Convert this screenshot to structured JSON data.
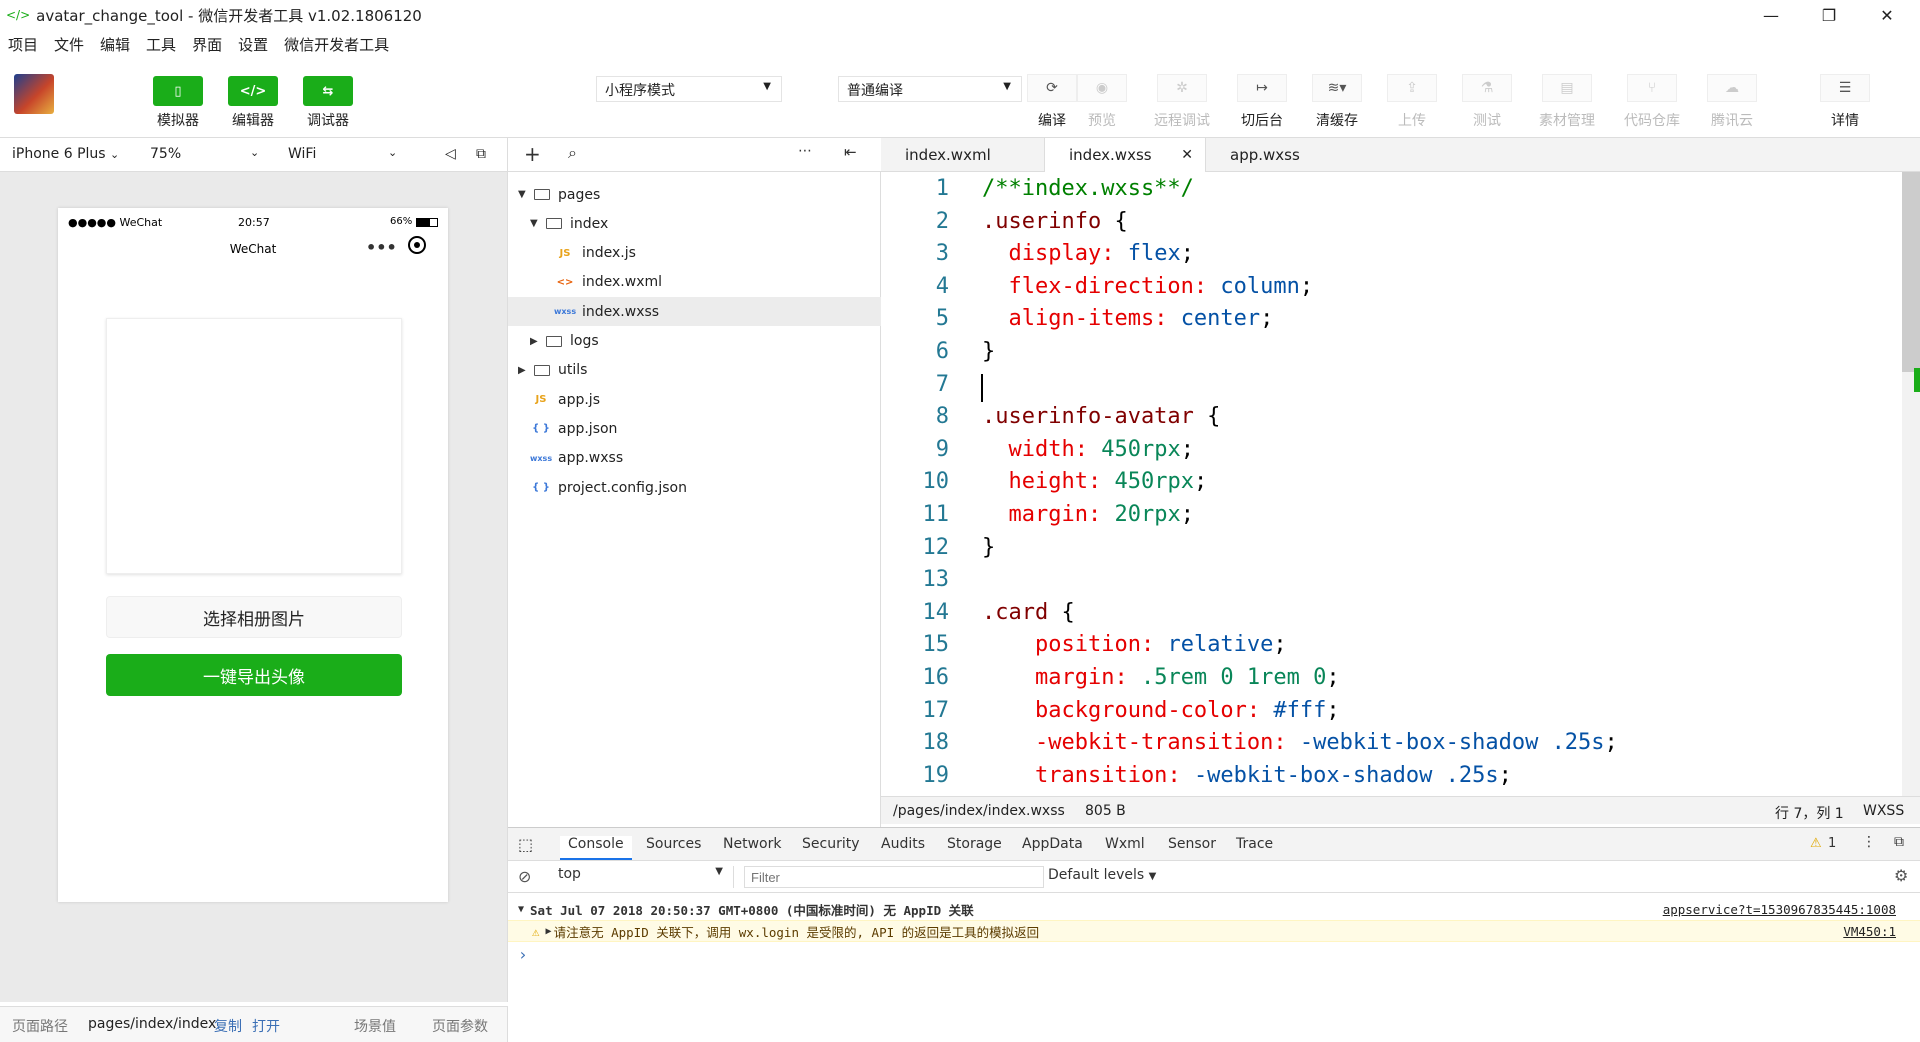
{
  "window": {
    "title": "avatar_change_tool - 微信开发者工具 v1.02.1806120",
    "minimize_glyph": "—",
    "restore_glyph": "❐",
    "close_glyph": "✕"
  },
  "menu": [
    "项目",
    "文件",
    "编辑",
    "工具",
    "界面",
    "设置",
    "微信开发者工具"
  ],
  "toolbar": {
    "simulator_label": "模拟器",
    "editor_label": "编辑器",
    "debugger_label": "调试器",
    "mode_select": "小程序模式",
    "compile_select": "普通编译",
    "compile_label": "编译",
    "preview_label": "预览",
    "remote_debug_label": "远程调试",
    "background_label": "切后台",
    "clear_cache_label": "清缓存",
    "upload_label": "上传",
    "test_label": "测试",
    "assets_label": "素材管理",
    "repo_label": "代码仓库",
    "tencent_cloud_label": "腾讯云",
    "details_label": "详情"
  },
  "simulator": {
    "device": "iPhone 6 Plus",
    "zoom": "75%",
    "network": "WiFi",
    "status_carrier": "●●●●● WeChat",
    "status_time": "20:57",
    "status_battery": "66%",
    "nav_title": "WeChat",
    "choose_button": "选择相册图片",
    "export_button": "一键导出头像"
  },
  "sim_footer": {
    "path_label": "页面路径",
    "path": "pages/index/index",
    "copy": "复制",
    "open": "打开",
    "scene": "场景值",
    "params": "页面参数"
  },
  "tree": [
    {
      "name": "pages",
      "type": "folder",
      "open": true,
      "depth": 0
    },
    {
      "name": "index",
      "type": "folder",
      "open": true,
      "depth": 1
    },
    {
      "name": "index.js",
      "type": "js",
      "depth": 2
    },
    {
      "name": "index.wxml",
      "type": "wxml",
      "depth": 2
    },
    {
      "name": "index.wxss",
      "type": "wxss",
      "depth": 2,
      "selected": true
    },
    {
      "name": "logs",
      "type": "folder",
      "open": false,
      "depth": 1
    },
    {
      "name": "utils",
      "type": "folder",
      "open": false,
      "depth": 0
    },
    {
      "name": "app.js",
      "type": "js",
      "depth": 0
    },
    {
      "name": "app.json",
      "type": "json",
      "depth": 0
    },
    {
      "name": "app.wxss",
      "type": "wxss",
      "depth": 0
    },
    {
      "name": "project.config.json",
      "type": "json",
      "depth": 0
    }
  ],
  "file_icons": {
    "js": "JS",
    "wxml": "<>",
    "wxss": "wxss",
    "json": "{ }"
  },
  "editor_tabs": [
    "index.wxml",
    "index.wxss",
    "app.wxss"
  ],
  "active_tab": "index.wxss",
  "code_lines": [
    [
      [
        "/**index.wxss**/",
        "cm"
      ]
    ],
    [
      [
        ".userinfo",
        "sel"
      ],
      [
        " {",
        "p"
      ]
    ],
    [
      [
        "  display",
        "prop"
      ],
      [
        ": ",
        "prop"
      ],
      [
        "flex",
        "val"
      ],
      [
        ";",
        "p"
      ]
    ],
    [
      [
        "  flex-direction",
        "prop"
      ],
      [
        ": ",
        "prop"
      ],
      [
        "column",
        "val"
      ],
      [
        ";",
        "p"
      ]
    ],
    [
      [
        "  align-items",
        "prop"
      ],
      [
        ": ",
        "prop"
      ],
      [
        "center",
        "val"
      ],
      [
        ";",
        "p"
      ]
    ],
    [
      [
        "}",
        "p"
      ]
    ],
    [
      [
        "",
        "p"
      ]
    ],
    [
      [
        ".userinfo-avatar",
        "sel"
      ],
      [
        " {",
        "p"
      ]
    ],
    [
      [
        "  width",
        "prop"
      ],
      [
        ": ",
        "prop"
      ],
      [
        "450rpx",
        "num"
      ],
      [
        ";",
        "p"
      ]
    ],
    [
      [
        "  height",
        "prop"
      ],
      [
        ": ",
        "prop"
      ],
      [
        "450rpx",
        "num"
      ],
      [
        ";",
        "p"
      ]
    ],
    [
      [
        "  margin",
        "prop"
      ],
      [
        ": ",
        "prop"
      ],
      [
        "20rpx",
        "num"
      ],
      [
        ";",
        "p"
      ]
    ],
    [
      [
        "}",
        "p"
      ]
    ],
    [
      [
        "",
        "p"
      ]
    ],
    [
      [
        ".card",
        "sel"
      ],
      [
        " {",
        "p"
      ]
    ],
    [
      [
        "    position",
        "prop"
      ],
      [
        ": ",
        "prop"
      ],
      [
        "relative",
        "val"
      ],
      [
        ";",
        "p"
      ]
    ],
    [
      [
        "    margin",
        "prop"
      ],
      [
        ": ",
        "prop"
      ],
      [
        ".5rem 0 1rem 0",
        "num"
      ],
      [
        ";",
        "p"
      ]
    ],
    [
      [
        "    background-color",
        "prop"
      ],
      [
        ": ",
        "prop"
      ],
      [
        "#fff",
        "val"
      ],
      [
        ";",
        "p"
      ]
    ],
    [
      [
        "    -webkit-transition",
        "prop"
      ],
      [
        ": ",
        "prop"
      ],
      [
        "-webkit-box-shadow .25s",
        "val"
      ],
      [
        ";",
        "p"
      ]
    ],
    [
      [
        "    transition",
        "prop"
      ],
      [
        ": ",
        "prop"
      ],
      [
        "-webkit-box-shadow .25s",
        "val"
      ],
      [
        ";",
        "p"
      ]
    ]
  ],
  "editor_status": {
    "path": "/pages/index/index.wxss",
    "size": "805 B",
    "cursor": "行 7，列 1",
    "lang": "WXSS"
  },
  "devtools": {
    "tabs": [
      "Console",
      "Sources",
      "Network",
      "Security",
      "Audits",
      "Storage",
      "AppData",
      "Wxml",
      "Sensor",
      "Trace"
    ],
    "active": "Console",
    "warn_count": "1",
    "context": "top",
    "filter_placeholder": "Filter",
    "levels": "Default levels",
    "group_header": "Sat Jul 07 2018 20:50:37 GMT+0800 (中国标准时间) 无 AppID 关联",
    "group_link": "appservice?t=1530967835445:1008",
    "warn_text": "请注意无 AppID 关联下，调用 wx.login 是受限的, API 的返回是工具的模拟返回",
    "warn_link": "VM450:1",
    "prompt": "›"
  },
  "colors": {
    "green": "#1aad19",
    "warn_bg": "#fffbe5"
  }
}
